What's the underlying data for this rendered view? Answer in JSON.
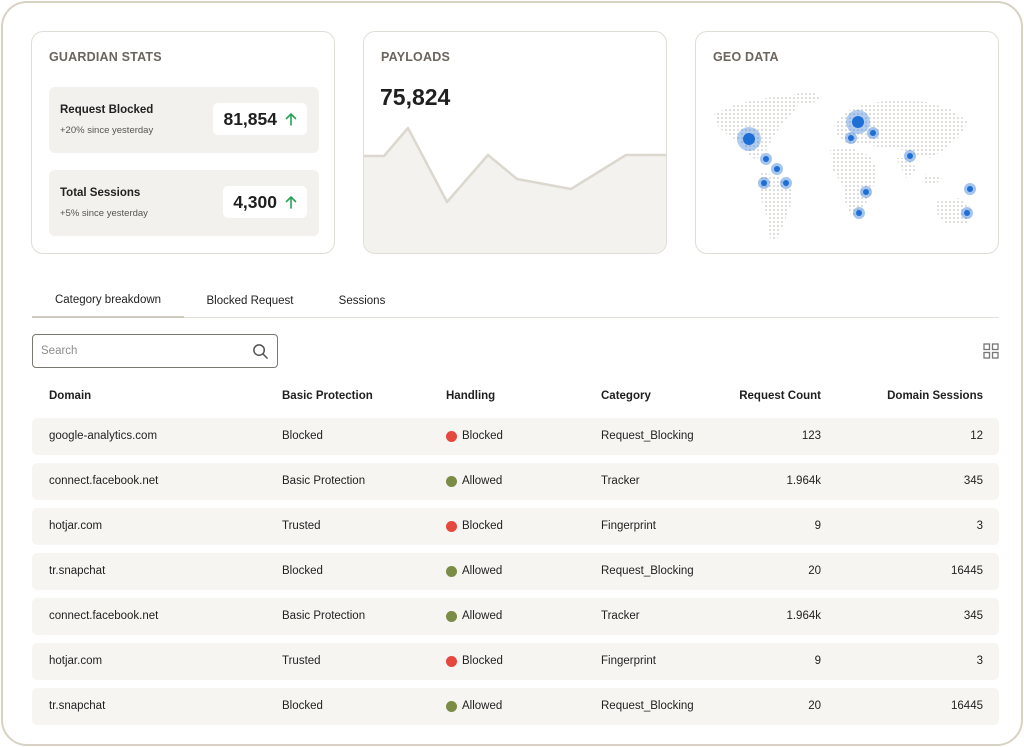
{
  "colors": {
    "accent_green": "#27a356",
    "blocked_dot": "#e5483f",
    "allowed_dot": "#7a8c45",
    "map_highlight": "#1d6fd6"
  },
  "guardian": {
    "title": "GUARDIAN STATS",
    "stats": [
      {
        "label": "Request Blocked",
        "sub": "+20% since yesterday",
        "value": "81,854",
        "icon": "arrow-up-icon"
      },
      {
        "label": "Total Sessions",
        "sub": "+5% since yesterday",
        "value": "4,300",
        "icon": "arrow-up-icon"
      }
    ]
  },
  "payloads": {
    "title": "PAYLOADS",
    "value": "75,824"
  },
  "geo": {
    "title": "GEO DATA"
  },
  "tabs": [
    {
      "label": "Category breakdown",
      "active": true
    },
    {
      "label": "Blocked Request",
      "active": false
    },
    {
      "label": "Sessions",
      "active": false
    }
  ],
  "search": {
    "placeholder": "Search",
    "icon": "search-icon"
  },
  "view_toggle_icon": "grid-icon",
  "table": {
    "headers": [
      "Domain",
      "Basic Protection",
      "Handling",
      "Category",
      "Request Count",
      "Domain Sessions"
    ],
    "rows": [
      {
        "domain": "google-analytics.com",
        "protection": "Blocked",
        "handling": "Blocked",
        "category": "Request_Blocking",
        "requests": "123",
        "sessions": "12"
      },
      {
        "domain": "connect.facebook.net",
        "protection": "Basic Protection",
        "handling": "Allowed",
        "category": "Tracker",
        "requests": "1.964k",
        "sessions": "345"
      },
      {
        "domain": "hotjar.com",
        "protection": "Trusted",
        "handling": "Blocked",
        "category": "Fingerprint",
        "requests": "9",
        "sessions": "3"
      },
      {
        "domain": "tr.snapchat",
        "protection": "Blocked",
        "handling": "Allowed",
        "category": "Request_Blocking",
        "requests": "20",
        "sessions": "16445"
      },
      {
        "domain": "connect.facebook.net",
        "protection": "Basic Protection",
        "handling": "Allowed",
        "category": "Tracker",
        "requests": "1.964k",
        "sessions": "345"
      },
      {
        "domain": "hotjar.com",
        "protection": "Trusted",
        "handling": "Blocked",
        "category": "Fingerprint",
        "requests": "9",
        "sessions": "3"
      },
      {
        "domain": "tr.snapchat",
        "protection": "Blocked",
        "handling": "Allowed",
        "category": "Request_Blocking",
        "requests": "20",
        "sessions": "16445"
      }
    ]
  }
}
